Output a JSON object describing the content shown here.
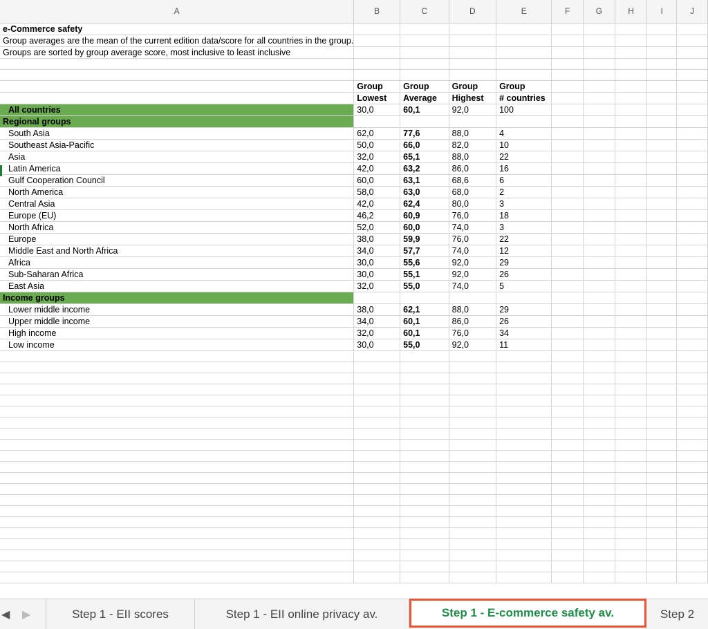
{
  "columns": [
    "A",
    "B",
    "C",
    "D",
    "E",
    "F",
    "G",
    "H",
    "I",
    "J"
  ],
  "title": "e-Commerce safety",
  "notes": [
    "Group averages are the mean of the current edition data/score for all countries in the group.",
    "Groups are sorted by group average score, most inclusive to least inclusive"
  ],
  "header_row1": [
    "Group",
    "Group",
    "Group",
    "Group"
  ],
  "header_row2": [
    "Lowest",
    "Average",
    "Highest",
    "# countries"
  ],
  "all_countries": {
    "label": "All countries",
    "lowest": "30,0",
    "average": "60,1",
    "highest": "92,0",
    "count": "100"
  },
  "regional_label": "Regional groups",
  "regional": [
    {
      "label": "South Asia",
      "lowest": "62,0",
      "average": "77,6",
      "highest": "88,0",
      "count": "4"
    },
    {
      "label": "Southeast Asia-Pacific",
      "lowest": "50,0",
      "average": "66,0",
      "highest": "82,0",
      "count": "10"
    },
    {
      "label": "Asia",
      "lowest": "32,0",
      "average": "65,1",
      "highest": "88,0",
      "count": "22"
    },
    {
      "label": "Latin America",
      "lowest": "42,0",
      "average": "63,2",
      "highest": "86,0",
      "count": "16"
    },
    {
      "label": "Gulf Cooperation Council",
      "lowest": "60,0",
      "average": "63,1",
      "highest": "68,6",
      "count": "6"
    },
    {
      "label": "North America",
      "lowest": "58,0",
      "average": "63,0",
      "highest": "68,0",
      "count": "2"
    },
    {
      "label": "Central Asia",
      "lowest": "42,0",
      "average": "62,4",
      "highest": "80,0",
      "count": "3"
    },
    {
      "label": "Europe (EU)",
      "lowest": "46,2",
      "average": "60,9",
      "highest": "76,0",
      "count": "18"
    },
    {
      "label": "North Africa",
      "lowest": "52,0",
      "average": "60,0",
      "highest": "74,0",
      "count": "3"
    },
    {
      "label": "Europe",
      "lowest": "38,0",
      "average": "59,9",
      "highest": "76,0",
      "count": "22"
    },
    {
      "label": "Middle East and North Africa",
      "lowest": "34,0",
      "average": "57,7",
      "highest": "74,0",
      "count": "12"
    },
    {
      "label": "Africa",
      "lowest": "30,0",
      "average": "55,6",
      "highest": "92,0",
      "count": "29"
    },
    {
      "label": "Sub-Saharan Africa",
      "lowest": "30,0",
      "average": "55,1",
      "highest": "92,0",
      "count": "26"
    },
    {
      "label": "East Asia",
      "lowest": "32,0",
      "average": "55,0",
      "highest": "74,0",
      "count": "5"
    }
  ],
  "income_label": "Income groups",
  "income": [
    {
      "label": "Lower middle income",
      "lowest": "38,0",
      "average": "62,1",
      "highest": "88,0",
      "count": "29"
    },
    {
      "label": "Upper middle income",
      "lowest": "34,0",
      "average": "60,1",
      "highest": "86,0",
      "count": "26"
    },
    {
      "label": "High income",
      "lowest": "32,0",
      "average": "60,1",
      "highest": "76,0",
      "count": "34"
    },
    {
      "label": "Low income",
      "lowest": "30,0",
      "average": "55,0",
      "highest": "92,0",
      "count": "11"
    }
  ],
  "tabs": [
    {
      "label": "Step 1 - EII scores",
      "active": false
    },
    {
      "label": "Step 1 - EII online privacy av.",
      "active": false
    },
    {
      "label": "Step 1 - E-commerce safety av.",
      "active": true
    },
    {
      "label": "Step 2",
      "active": false
    }
  ],
  "icons": {
    "prev": "tab-scroll-left-icon",
    "next": "tab-scroll-right-icon"
  },
  "colors": {
    "group_fill": "#6aab4f",
    "active_tab_text": "#1f8c4a",
    "active_tab_border": "#e8533a"
  }
}
